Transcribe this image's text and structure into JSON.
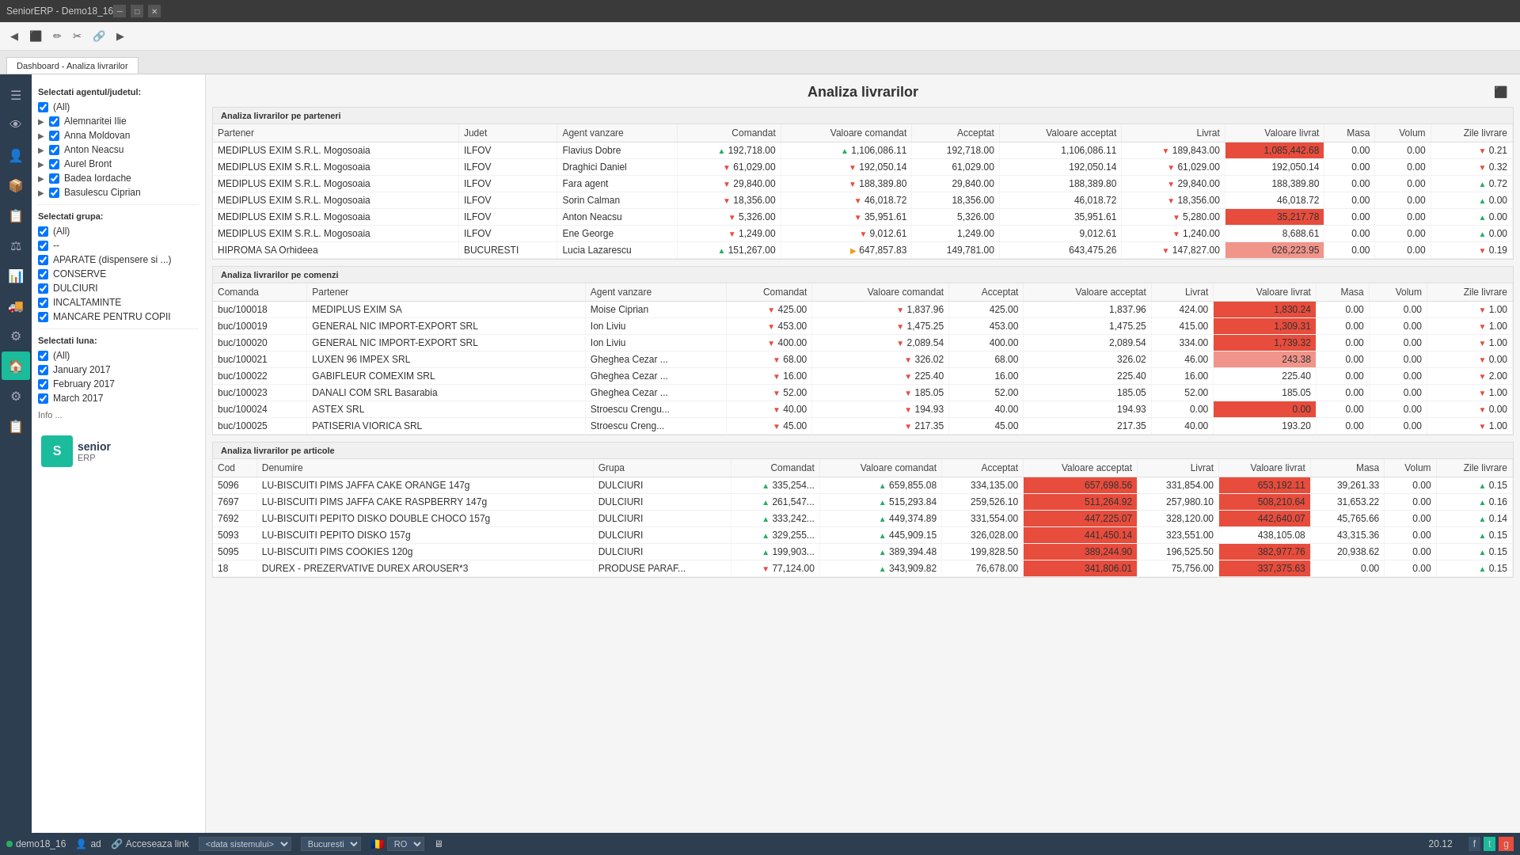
{
  "app": {
    "title": "SeniorERP - Demo18_16",
    "tab_label": "Dashboard - Analiza livrarilor",
    "page_title": "Analiza livrarilor"
  },
  "toolbar": {
    "buttons": [
      "⬅",
      "⬛",
      "✏",
      "✂",
      "🔗",
      "▶"
    ]
  },
  "sidebar_icons": [
    "☰",
    "👁",
    "👤",
    "📦",
    "📋",
    "⚖",
    "📊",
    "🚚",
    "⚙",
    "🏠",
    "⚙",
    "📋"
  ],
  "filter": {
    "agent_label": "Selectati agentul/judetul:",
    "all_label": "(All)",
    "agents": [
      {
        "name": "Alemnaritei Ilie",
        "checked": true
      },
      {
        "name": "Anna Moldovan",
        "checked": true
      },
      {
        "name": "Anton Neacsu",
        "checked": true
      },
      {
        "name": "Aurel Bront",
        "checked": true
      },
      {
        "name": "Badea Iordache",
        "checked": true
      },
      {
        "name": "Basulescu Ciprian",
        "checked": true
      }
    ],
    "group_label": "Selectati grupa:",
    "groups": [
      {
        "name": "(All)",
        "checked": true
      },
      {
        "name": "--",
        "checked": true
      },
      {
        "name": "APARATE (dispensere si ...)",
        "checked": true
      },
      {
        "name": "CONSERVE",
        "checked": true
      },
      {
        "name": "DULCIURI",
        "checked": true
      },
      {
        "name": "INCALTAMINTE",
        "checked": true
      },
      {
        "name": "MANCARE PENTRU COPII",
        "checked": true
      }
    ],
    "month_label": "Selectati luna:",
    "months": [
      {
        "name": "(All)",
        "checked": true
      },
      {
        "name": "January 2017",
        "checked": true
      },
      {
        "name": "February 2017",
        "checked": true
      },
      {
        "name": "March 2017",
        "checked": true
      }
    ],
    "info_label": "Info ..."
  },
  "sections": {
    "partners": {
      "title": "Analiza livrarilor pe parteneri",
      "columns": [
        "Partener",
        "Judet",
        "Agent vanzare",
        "Comandat",
        "Valoare comandat",
        "Acceptat",
        "Valoare acceptat",
        "Livrat",
        "Valoare livrat",
        "Masa",
        "Volum",
        "Zile livrare"
      ],
      "rows": [
        {
          "partener": "MEDIPLUS EXIM S.R.L. Mogosoaia",
          "judet": "ILFOV",
          "agent": "Flavius Dobre",
          "cmd_arrow": "up",
          "comandat": "192,718.00",
          "vc_arrow": "up",
          "valoare_cmd": "1,106,086.11",
          "acceptat": "192,718.00",
          "valoare_acc": "1,106,086.11",
          "livrat": "189,843.00",
          "livrat_arrow": "down",
          "valoare_livrat": "1,085,442.68",
          "vl_highlight": "red",
          "masa": "0.00",
          "volum": "0.00",
          "zile_arrow": "down",
          "zile": "0.21"
        },
        {
          "partener": "MEDIPLUS EXIM S.R.L. Mogosoaia",
          "judet": "ILFOV",
          "agent": "Draghici Daniel",
          "cmd_arrow": "down",
          "comandat": "61,029.00",
          "vc_arrow": "down",
          "valoare_cmd": "192,050.14",
          "acceptat": "61,029.00",
          "valoare_acc": "192,050.14",
          "livrat": "61,029.00",
          "livrat_arrow": "down",
          "valoare_livrat": "192,050.14",
          "vl_highlight": "none",
          "masa": "0.00",
          "volum": "0.00",
          "zile_arrow": "down",
          "zile": "0.32"
        },
        {
          "partener": "MEDIPLUS EXIM S.R.L. Mogosoaia",
          "judet": "ILFOV",
          "agent": "Fara agent",
          "cmd_arrow": "down",
          "comandat": "29,840.00",
          "vc_arrow": "down",
          "valoare_cmd": "188,389.80",
          "acceptat": "29,840.00",
          "valoare_acc": "188,389.80",
          "livrat": "29,840.00",
          "livrat_arrow": "down",
          "valoare_livrat": "188,389.80",
          "vl_highlight": "none",
          "masa": "0.00",
          "volum": "0.00",
          "zile_arrow": "up",
          "zile": "0.72"
        },
        {
          "partener": "MEDIPLUS EXIM S.R.L. Mogosoaia",
          "judet": "ILFOV",
          "agent": "Sorin Calman",
          "cmd_arrow": "down",
          "comandat": "18,356.00",
          "vc_arrow": "down",
          "valoare_cmd": "46,018.72",
          "acceptat": "18,356.00",
          "valoare_acc": "46,018.72",
          "livrat": "18,356.00",
          "livrat_arrow": "down",
          "valoare_livrat": "46,018.72",
          "vl_highlight": "none",
          "masa": "0.00",
          "volum": "0.00",
          "zile_arrow": "up",
          "zile": "0.00"
        },
        {
          "partener": "MEDIPLUS EXIM S.R.L. Mogosoaia",
          "judet": "ILFOV",
          "agent": "Anton Neacsu",
          "cmd_arrow": "down",
          "comandat": "5,326.00",
          "vc_arrow": "down",
          "valoare_cmd": "35,951.61",
          "acceptat": "5,326.00",
          "valoare_acc": "35,951.61",
          "livrat": "5,280.00",
          "livrat_arrow": "down",
          "valoare_livrat": "35,217.78",
          "vl_highlight": "red",
          "masa": "0.00",
          "volum": "0.00",
          "zile_arrow": "up",
          "zile": "0.00"
        },
        {
          "partener": "MEDIPLUS EXIM S.R.L. Mogosoaia",
          "judet": "ILFOV",
          "agent": "Ene George",
          "cmd_arrow": "down",
          "comandat": "1,249.00",
          "vc_arrow": "down",
          "valoare_cmd": "9,012.61",
          "acceptat": "1,249.00",
          "valoare_acc": "9,012.61",
          "livrat": "1,240.00",
          "livrat_arrow": "down",
          "valoare_livrat": "8,688.61",
          "vl_highlight": "none",
          "masa": "0.00",
          "volum": "0.00",
          "zile_arrow": "up",
          "zile": "0.00"
        },
        {
          "partener": "HIPROMA SA Orhideea",
          "judet": "BUCURESTI",
          "agent": "Lucia Lazarescu",
          "cmd_arrow": "up",
          "comandat": "151,267.00",
          "vc_arrow": "yellow",
          "valoare_cmd": "647,857.83",
          "acceptat": "149,781.00",
          "valoare_acc": "643,475.26",
          "livrat": "147,827.00",
          "livrat_arrow": "down",
          "valoare_livrat": "626,223.95",
          "vl_highlight": "pink",
          "masa": "0.00",
          "volum": "0.00",
          "zile_arrow": "down",
          "zile": "0.19"
        }
      ]
    },
    "orders": {
      "title": "Analiza livrarilor pe comenzi",
      "columns": [
        "Comanda",
        "Partener",
        "Agent vanzare",
        "Comandat",
        "Valoare comandat",
        "Acceptat",
        "Valoare acceptat",
        "Livrat",
        "Valoare livrat",
        "Masa",
        "Volum",
        "Zile livrare"
      ],
      "rows": [
        {
          "comanda": "buc/100018",
          "partener": "MEDIPLUS EXIM SA",
          "agent": "Moise Ciprian",
          "cmd_arrow": "down",
          "comandat": "425.00",
          "vc_arrow": "down",
          "valoare_cmd": "1,837.96",
          "acceptat": "425.00",
          "valoare_acc": "1,837.96",
          "livrat": "424.00",
          "livrat_arrow": "down",
          "valoare_livrat": "1,830.24",
          "vl_highlight": "red",
          "masa": "0.00",
          "volum": "0.00",
          "zile_arrow": "down",
          "zile": "1.00"
        },
        {
          "comanda": "buc/100019",
          "partener": "GENERAL NIC IMPORT-EXPORT SRL",
          "agent": "Ion Liviu",
          "cmd_arrow": "down",
          "comandat": "453.00",
          "vc_arrow": "down",
          "valoare_cmd": "1,475.25",
          "acceptat": "453.00",
          "valoare_acc": "1,475.25",
          "livrat": "415.00",
          "livrat_arrow": "down",
          "valoare_livrat": "1,309.31",
          "vl_highlight": "red",
          "masa": "0.00",
          "volum": "0.00",
          "zile_arrow": "down",
          "zile": "1.00"
        },
        {
          "comanda": "buc/100020",
          "partener": "GENERAL NIC IMPORT-EXPORT SRL",
          "agent": "Ion Liviu",
          "cmd_arrow": "down",
          "comandat": "400.00",
          "vc_arrow": "down",
          "valoare_cmd": "2,089.54",
          "acceptat": "400.00",
          "valoare_acc": "2,089.54",
          "livrat": "334.00",
          "livrat_arrow": "down",
          "valoare_livrat": "1,739.32",
          "vl_highlight": "red",
          "masa": "0.00",
          "volum": "0.00",
          "zile_arrow": "down",
          "zile": "1.00"
        },
        {
          "comanda": "buc/100021",
          "partener": "LUXEN 96 IMPEX SRL",
          "agent": "Gheghea Cezar ...",
          "cmd_arrow": "down",
          "comandat": "68.00",
          "vc_arrow": "down",
          "valoare_cmd": "326.02",
          "acceptat": "68.00",
          "valoare_acc": "326.02",
          "livrat": "46.00",
          "livrat_arrow": "down",
          "valoare_livrat": "243.38",
          "vl_highlight": "pink",
          "masa": "0.00",
          "volum": "0.00",
          "zile_arrow": "down",
          "zile": "0.00"
        },
        {
          "comanda": "buc/100022",
          "partener": "GABIFLEUR COMEXIM SRL",
          "agent": "Gheghea Cezar ...",
          "cmd_arrow": "down",
          "comandat": "16.00",
          "vc_arrow": "down",
          "valoare_cmd": "225.40",
          "acceptat": "16.00",
          "valoare_acc": "225.40",
          "livrat": "16.00",
          "livrat_arrow": "down",
          "valoare_livrat": "225.40",
          "vl_highlight": "none",
          "masa": "0.00",
          "volum": "0.00",
          "zile_arrow": "down",
          "zile": "2.00"
        },
        {
          "comanda": "buc/100023",
          "partener": "DANALI COM SRL Basarabia",
          "agent": "Gheghea Cezar ...",
          "cmd_arrow": "down",
          "comandat": "52.00",
          "vc_arrow": "down",
          "valoare_cmd": "185.05",
          "acceptat": "52.00",
          "valoare_acc": "185.05",
          "livrat": "52.00",
          "livrat_arrow": "down",
          "valoare_livrat": "185.05",
          "vl_highlight": "none",
          "masa": "0.00",
          "volum": "0.00",
          "zile_arrow": "down",
          "zile": "1.00"
        },
        {
          "comanda": "buc/100024",
          "partener": "ASTEX SRL",
          "agent": "Stroescu Crengu...",
          "cmd_arrow": "down",
          "comandat": "40.00",
          "vc_arrow": "down",
          "valoare_cmd": "194.93",
          "acceptat": "40.00",
          "valoare_acc": "194.93",
          "livrat": "0.00",
          "livrat_arrow": "down",
          "valoare_livrat": "0.00",
          "vl_highlight": "red_zero",
          "masa": "0.00",
          "volum": "0.00",
          "zile_arrow": "down",
          "zile": "0.00"
        },
        {
          "comanda": "buc/100025",
          "partener": "PATISERIA VIORICA SRL",
          "agent": "Stroescu Creng...",
          "cmd_arrow": "down",
          "comandat": "45.00",
          "vc_arrow": "down",
          "valoare_cmd": "217.35",
          "acceptat": "45.00",
          "valoare_acc": "217.35",
          "livrat": "40.00",
          "livrat_arrow": "down",
          "valoare_livrat": "193.20",
          "vl_highlight": "none",
          "masa": "0.00",
          "volum": "0.00",
          "zile_arrow": "down",
          "zile": "1.00"
        }
      ]
    },
    "articles": {
      "title": "Analiza livrarilor pe articole",
      "columns": [
        "Cod",
        "Denumire",
        "Grupa",
        "Comandat",
        "Valoare comandat",
        "Acceptat",
        "Valoare acceptat",
        "Livrat",
        "Valoare livrat",
        "Masa",
        "Volum",
        "Zile livrare"
      ],
      "rows": [
        {
          "cod": "5096",
          "denumire": "LU-BISCUITI PIMS JAFFA CAKE ORANGE 147g",
          "grupa": "DULCIURI",
          "cmd_arrow": "up",
          "comandat": "335,254...",
          "vc_arrow": "up",
          "valoare_cmd": "659,855.08",
          "acceptat": "334,135.00",
          "valoare_acc": "657,698.56",
          "livrat": "331,854.00",
          "livrat_arrow": "down",
          "valoare_livrat": "653,192.11",
          "vl_highlight": "red",
          "masa": "39,261.33",
          "volum": "0.00",
          "zile_arrow": "up",
          "zile": "0.15"
        },
        {
          "cod": "7697",
          "denumire": "LU-BISCUITI PIMS JAFFA CAKE RASPBERRY 147g",
          "grupa": "DULCIURI",
          "cmd_arrow": "up",
          "comandat": "261,547...",
          "vc_arrow": "up",
          "valoare_cmd": "515,293.84",
          "acceptat": "259,526.10",
          "valoare_acc": "511,264.92",
          "livrat": "257,980.10",
          "livrat_arrow": "down",
          "valoare_livrat": "508,210.64",
          "vl_highlight": "red",
          "masa": "31,653.22",
          "volum": "0.00",
          "zile_arrow": "up",
          "zile": "0.16"
        },
        {
          "cod": "7692",
          "denumire": "LU-BISCUITI PEPITO DISKO DOUBLE CHOCO 157g",
          "grupa": "DULCIURI",
          "cmd_arrow": "up",
          "comandat": "333,242...",
          "vc_arrow": "up",
          "valoare_cmd": "449,374.89",
          "acceptat": "331,554.00",
          "valoare_acc": "447,225.07",
          "livrat": "328,120.00",
          "livrat_arrow": "down",
          "valoare_livrat": "442,640.07",
          "vl_highlight": "red",
          "masa": "45,765.66",
          "volum": "0.00",
          "zile_arrow": "up",
          "zile": "0.14"
        },
        {
          "cod": "5093",
          "denumire": "LU-BISCUITI PEPITO DISKO 157g",
          "grupa": "DULCIURI",
          "cmd_arrow": "up",
          "comandat": "329,255...",
          "vc_arrow": "up",
          "valoare_cmd": "445,909.15",
          "acceptat": "326,028.00",
          "valoare_acc": "441,450.14",
          "livrat": "323,551.00",
          "livrat_arrow": "down",
          "valoare_livrat": "438,105.08",
          "vl_highlight": "none",
          "masa": "43,315.36",
          "volum": "0.00",
          "zile_arrow": "up",
          "zile": "0.15"
        },
        {
          "cod": "5095",
          "denumire": "LU-BISCUITI PIMS COOKIES 120g",
          "grupa": "DULCIURI",
          "cmd_arrow": "up",
          "comandat": "199,903...",
          "vc_arrow": "up",
          "valoare_cmd": "389,394.48",
          "acceptat": "199,828.50",
          "valoare_acc": "389,244.90",
          "livrat": "196,525.50",
          "livrat_arrow": "down",
          "valoare_livrat": "382,977.76",
          "vl_highlight": "red",
          "masa": "20,938.62",
          "volum": "0.00",
          "zile_arrow": "up",
          "zile": "0.15"
        },
        {
          "cod": "18",
          "denumire": "DUREX - PREZERVATIVE DUREX AROUSER*3",
          "grupa": "PRODUSE PARAF...",
          "cmd_arrow": "down",
          "comandat": "77,124.00",
          "vc_arrow": "up",
          "valoare_cmd": "343,909.82",
          "acceptat": "76,678.00",
          "valoare_acc": "341,806.01",
          "livrat": "75,756.00",
          "livrat_arrow": "down",
          "valoare_livrat": "337,375.63",
          "vl_highlight": "red",
          "masa": "0.00",
          "volum": "0.00",
          "zile_arrow": "up",
          "zile": "0.15"
        }
      ]
    }
  },
  "status_bar": {
    "instance": "demo18_16",
    "user": "ad",
    "link_label": "Acceseaza link",
    "date_system": "<data sistemului>",
    "city": "Bucuresti",
    "country": "RO",
    "time": "20.12"
  }
}
